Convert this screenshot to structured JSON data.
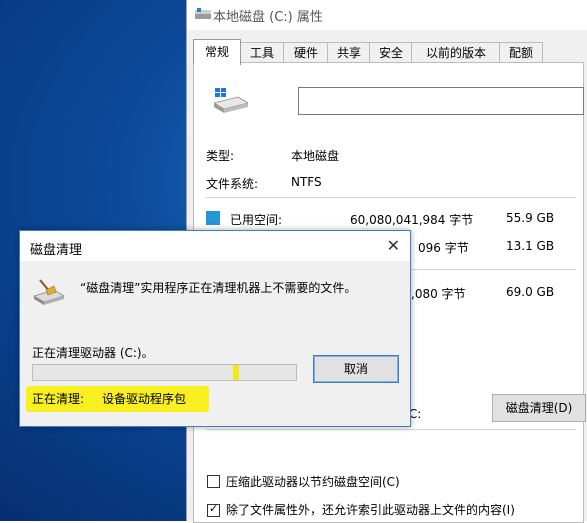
{
  "properties": {
    "title": "本地磁盘 (C:) 属性",
    "tabs": [
      "常规",
      "工具",
      "硬件",
      "共享",
      "安全",
      "以前的版本",
      "配额"
    ],
    "active_tab": "常规",
    "volume_label_value": "",
    "type_label": "类型:",
    "type_value": "本地磁盘",
    "fs_label": "文件系统:",
    "fs_value": "NTFS",
    "used": {
      "label": "已用空间:",
      "bytes": "60,080,041,984 字节",
      "size": "55.9 GB"
    },
    "free": {
      "bytes_partial": "096 字节",
      "size": "13.1 GB"
    },
    "capacity": {
      "bytes_partial": ",080 字节",
      "size": "69.0 GB"
    },
    "drive_caption_partial": "驱动器 C:",
    "disk_cleanup_button": "磁盘清理(D)",
    "compress_checkbox": {
      "label": "压缩此驱动器以节约磁盘空间(C)",
      "checked": false
    },
    "index_checkbox": {
      "label": "除了文件属性外，还允许索引此驱动器上文件的内容(I)",
      "checked": true
    },
    "colors": {
      "used": "#2596d8",
      "free": "#d8d8d8"
    }
  },
  "dialog": {
    "title": "磁盘清理",
    "close_glyph": "✕",
    "message": "“磁盘清理”实用程序正在清理机器上不需要的文件。",
    "cleaning_drive": "正在清理驱动器  (C:)。",
    "progress": 0.76,
    "cancel_button": "取消",
    "current_label": "正在清理:",
    "current_value": "设备驱动程序包",
    "highlight_color": "#f7ef20"
  }
}
